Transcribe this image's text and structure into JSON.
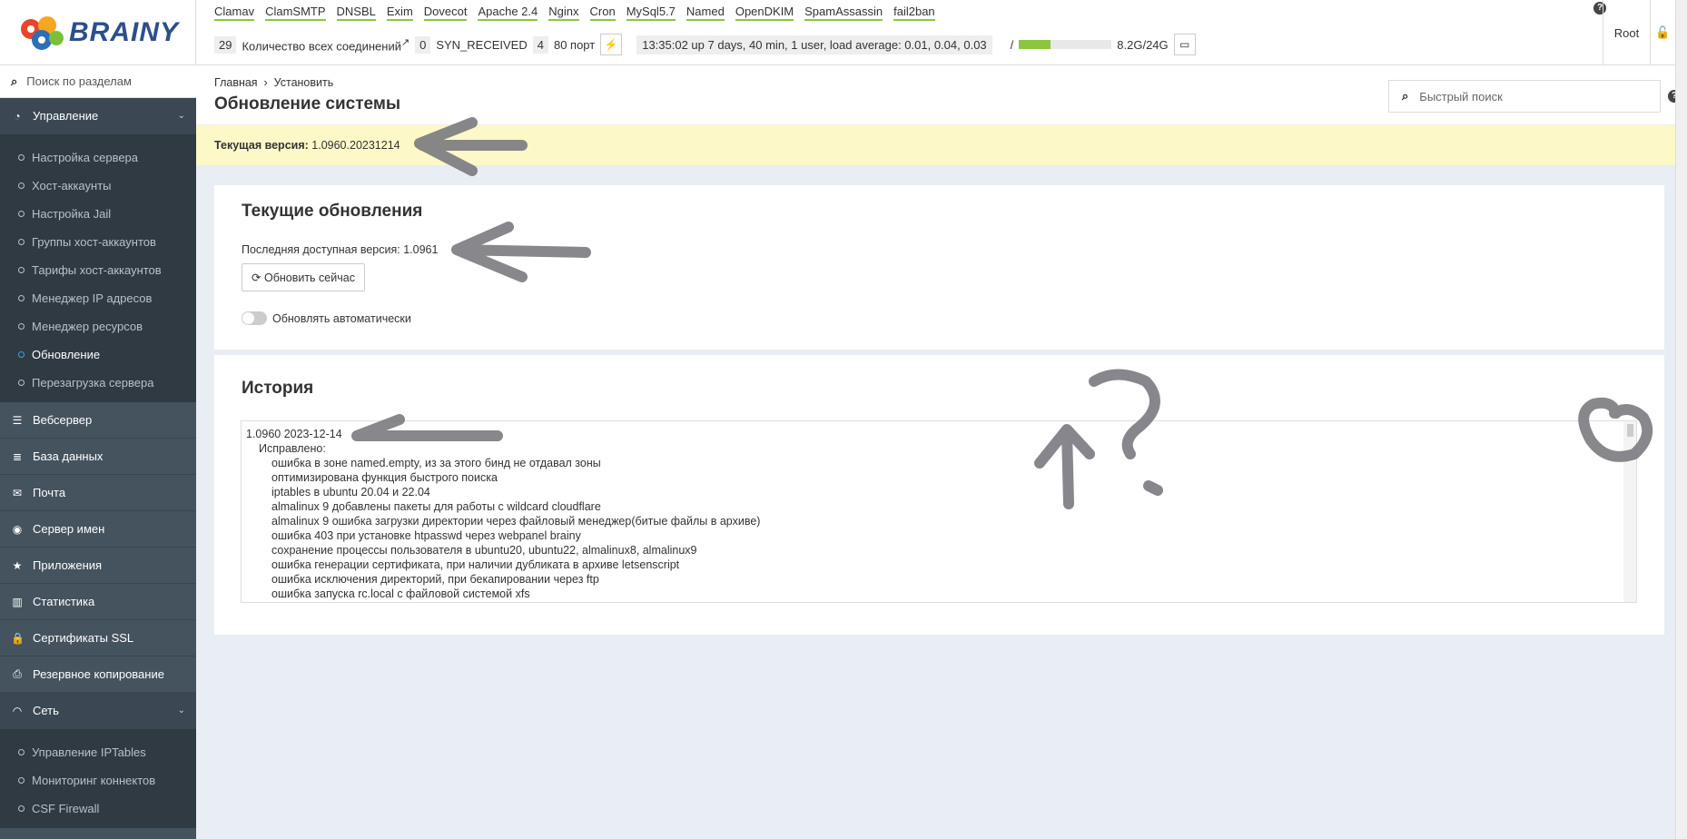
{
  "brand": "BRAINY",
  "services": [
    "Clamav",
    "ClamSMTP",
    "DNSBL",
    "Exim",
    "Dovecot",
    "Apache 2.4",
    "Nginx",
    "Cron",
    "MySql5.7",
    "Named",
    "OpenDKIM",
    "SpamAssassin",
    "fail2ban"
  ],
  "stats": {
    "connections_count": "29",
    "connections_label": "Количество всех соединений",
    "syn_count": "0",
    "syn_label": "SYN_RECEIVED",
    "port_count": "4",
    "port_label": "80 порт",
    "uptime": "13:35:02 up 7 days, 40 min, 1 user, load average: 0.01, 0.04, 0.03",
    "disk_mount": "/",
    "disk_usage": "8.2G/24G",
    "disk_fraction": 0.34
  },
  "user": "Root",
  "sidebar": {
    "search_placeholder": "Поиск по разделам",
    "management": {
      "label": "Управление",
      "items": [
        "Настройка сервера",
        "Хост-аккаунты",
        "Настройка Jail",
        "Группы хост-аккаунтов",
        "Тарифы хост-аккаунтов",
        "Менеджер IP адресов",
        "Менеджер ресурсов",
        "Обновление",
        "Перезагрузка сервера"
      ],
      "active": "Обновление"
    },
    "sections": [
      "Вебсервер",
      "База данных",
      "Почта",
      "Сервер имен",
      "Приложения",
      "Статистика",
      "Сертификаты SSL",
      "Резервное копирование"
    ],
    "network": {
      "label": "Сеть",
      "items": [
        "Управление IPTables",
        "Мониторинг коннектов",
        "CSF Firewall"
      ]
    }
  },
  "breadcrumb": [
    "Главная",
    "Установить"
  ],
  "page_title": "Обновление системы",
  "quick_search_placeholder": "Быстрый поиск",
  "current_version": {
    "label": "Текущая версия:",
    "value": "1.0960.20231214"
  },
  "updates": {
    "title": "Текущие обновления",
    "latest_label": "Последняя доступная версия: 1.0961",
    "update_button": "Обновить сейчас",
    "auto_label": "Обновлять автоматически",
    "auto_enabled": false
  },
  "history": {
    "title": "История",
    "lines": [
      {
        "level": 0,
        "text": "1.0960 2023-12-14"
      },
      {
        "level": 1,
        "text": "Исправлено:"
      },
      {
        "level": 2,
        "text": "ошибка в зоне named.empty, из за этого бинд не отдавал зоны"
      },
      {
        "level": 2,
        "text": "оптимизирована функция быстрого поиска"
      },
      {
        "level": 2,
        "text": "iptables в ubuntu 20.04 и 22.04"
      },
      {
        "level": 2,
        "text": "almalinux 9 добавлены пакеты для работы с wildcard cloudflare"
      },
      {
        "level": 2,
        "text": "almalinux 9 ошибка загрузки директории через файловый менеджер(битые файлы в архиве)"
      },
      {
        "level": 2,
        "text": "ошибка 403 при установке htpasswd через webpanel brainy"
      },
      {
        "level": 2,
        "text": "сохранение процессы пользователя в ubuntu20, ubuntu22, almalinux8, almalinux9"
      },
      {
        "level": 2,
        "text": "ошибка генерации сертификата, при наличии дубликата в архиве letsenscript"
      },
      {
        "level": 2,
        "text": "ошибка исключения директорий, при бекапировании через ftp"
      },
      {
        "level": 2,
        "text": "ошибка запуска rc.local с файловой системой xfs"
      }
    ]
  }
}
